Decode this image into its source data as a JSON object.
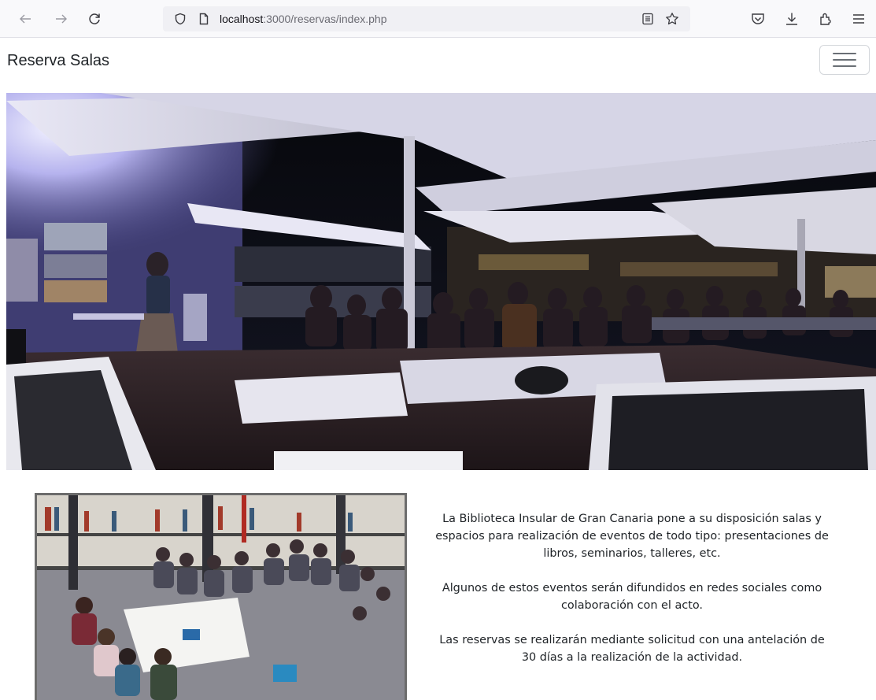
{
  "browser": {
    "url_host": "localhost",
    "url_path": ":3000/reservas/index.php",
    "icons": [
      "back-arrow-icon",
      "forward-arrow-icon",
      "reload-icon",
      "shield-icon",
      "page-icon",
      "reader-mode-icon",
      "bookmark-star-icon",
      "pocket-icon",
      "download-icon",
      "extensions-icon",
      "menu-icon"
    ]
  },
  "nav": {
    "brand": "Reserva Salas",
    "toggler_icon": "hamburger-icon"
  },
  "content": {
    "paragraphs": [
      "La Biblioteca Insular de Gran Canaria pone a su disposición salas y espacios para realización de eventos de todo tipo: presentaciones de libros, seminarios, talleres, etc.",
      "Algunos de estos eventos serán difundidos en redes sociales como colaboración con el acto.",
      "Las reservas se realizarán mediante solicitud con una antelación de 30 días a la realización de la actividad."
    ]
  },
  "colors": {
    "browser_bg": "#f9f9fb",
    "url_bg": "#f0f0f4",
    "text": "#212529"
  }
}
